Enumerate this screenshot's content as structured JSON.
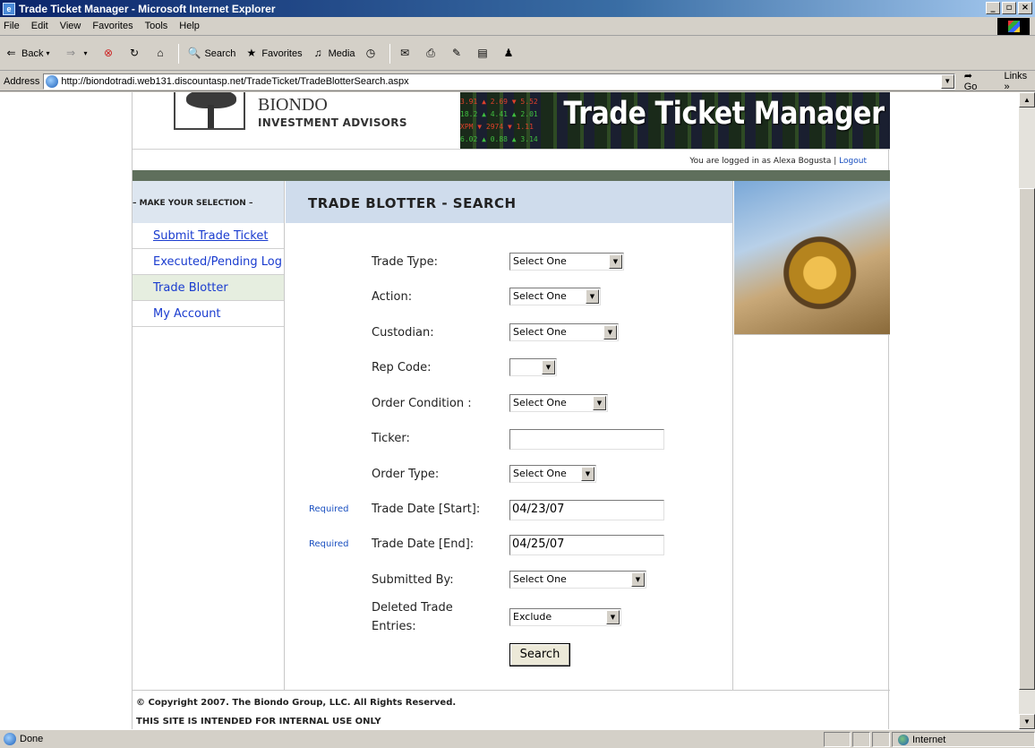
{
  "window": {
    "title": "Trade Ticket Manager - Microsoft Internet Explorer",
    "controls": [
      "_",
      "▫",
      "×"
    ]
  },
  "menu": [
    "File",
    "Edit",
    "View",
    "Favorites",
    "Tools",
    "Help"
  ],
  "toolbar": {
    "back": "Back",
    "search": "Search",
    "favorites": "Favorites",
    "media": "Media"
  },
  "address": {
    "label": "Address",
    "url": "http://biondotradi.web131.discountasp.net/TradeTicket/TradeBlotterSearch.aspx",
    "go": "Go",
    "links": "Links »"
  },
  "header": {
    "logo_name": "BIONDO",
    "logo_sub": "INVESTMENT ADVISORS",
    "banner_title": "Trade Ticket Manager",
    "login_text": "You are logged in as  Alexa Bogusta | ",
    "logout": "Logout"
  },
  "sidebar": {
    "heading": "– MAKE YOUR SELECTION –",
    "items": [
      {
        "label": "Submit Trade Ticket"
      },
      {
        "label": "Executed/Pending Log"
      },
      {
        "label": "Trade Blotter"
      },
      {
        "label": "My Account"
      }
    ]
  },
  "main": {
    "heading": "TRADE BLOTTER - SEARCH",
    "fields": {
      "trade_type": {
        "label": "Trade Type:",
        "value": "Select One"
      },
      "action": {
        "label": "Action:",
        "value": "Select One"
      },
      "custodian": {
        "label": "Custodian:",
        "value": "Select One"
      },
      "rep_code": {
        "label": "Rep Code:",
        "value": ""
      },
      "order_condition": {
        "label": "Order Condition :",
        "value": "Select One"
      },
      "ticker": {
        "label": "Ticker:",
        "value": ""
      },
      "order_type": {
        "label": "Order Type:",
        "value": "Select One"
      },
      "trade_date_start": {
        "label": "Trade Date [Start]:",
        "value": "04/23/07",
        "required": "Required"
      },
      "trade_date_end": {
        "label": "Trade Date [End]:",
        "value": "04/25/07",
        "required": "Required"
      },
      "submitted_by": {
        "label": "Submitted By:",
        "value": "Select One"
      },
      "deleted_entries": {
        "label_line1": "Deleted Trade",
        "label_line2": "Entries:",
        "value": "Exclude"
      }
    },
    "search_button": "Search"
  },
  "footer": {
    "copyright": "© Copyright 2007. The Biondo Group, LLC. All Rights Reserved.",
    "note": "THIS SITE IS INTENDED FOR INTERNAL USE ONLY"
  },
  "status": {
    "text": "Done",
    "zone": "Internet"
  }
}
